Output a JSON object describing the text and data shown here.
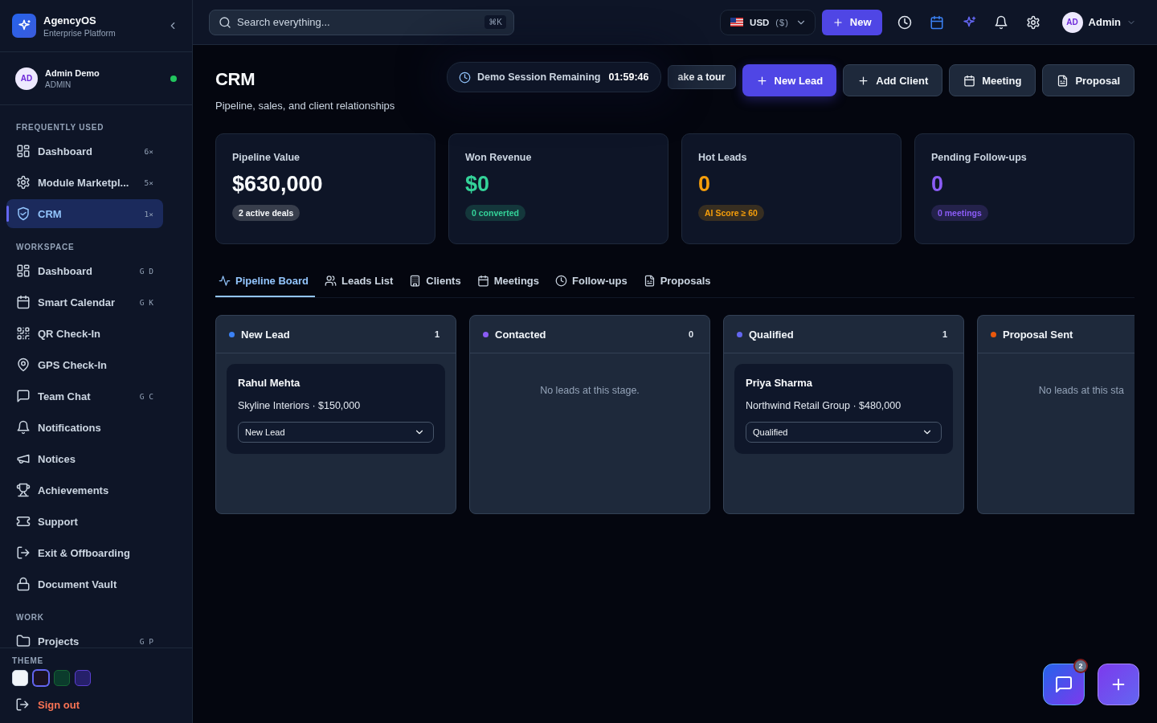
{
  "sidebar": {
    "brand": {
      "name": "AgencyOS",
      "subtitle": "Enterprise Platform"
    },
    "user": {
      "initials": "AD",
      "name": "Admin Demo",
      "role": "ADMIN",
      "online": true
    },
    "sections": [
      {
        "title": "FREQUENTLY USED",
        "items": [
          {
            "label": "Dashboard",
            "hint": "6×",
            "selected": false
          },
          {
            "label": "Module Marketpl...",
            "hint": "5×",
            "selected": false
          },
          {
            "label": "CRM",
            "hint": "1×",
            "selected": true
          }
        ]
      },
      {
        "title": "WORKSPACE",
        "items": [
          {
            "label": "Dashboard",
            "hint": "G D",
            "selected": false
          },
          {
            "label": "Smart Calendar",
            "hint": "G K",
            "selected": false
          },
          {
            "label": "QR Check-In",
            "selected": false
          },
          {
            "label": "GPS Check-In",
            "selected": false
          },
          {
            "label": "Team Chat",
            "hint": "G C",
            "selected": false
          },
          {
            "label": "Notifications",
            "selected": false
          },
          {
            "label": "Notices",
            "selected": false
          },
          {
            "label": "Achievements",
            "selected": false
          },
          {
            "label": "Support",
            "selected": false
          },
          {
            "label": "Exit & Offboarding",
            "selected": false
          },
          {
            "label": "Document Vault",
            "selected": false
          }
        ]
      },
      {
        "title": "WORK",
        "items": [
          {
            "label": "Projects",
            "hint": "G P",
            "selected": false
          }
        ]
      }
    ],
    "theme": {
      "title": "THEME",
      "swatches": [
        {
          "color": "#f1f5f9",
          "selected": false
        },
        {
          "color": "#1a1222",
          "selected": true
        },
        {
          "color": "#0b3b2c",
          "selected": false
        },
        {
          "color": "#26206a",
          "selected": false
        }
      ]
    },
    "sign_out": "Sign out"
  },
  "topbar": {
    "search": {
      "placeholder": "Search everything...",
      "shortcut": "⌘K"
    },
    "currency": {
      "code": "USD",
      "symbol": "($)"
    },
    "new_button": "New",
    "user": {
      "initials": "AD",
      "name": "Admin"
    }
  },
  "page": {
    "title": "CRM",
    "subtitle": "Pipeline, sales, and client relationships",
    "demo": {
      "label": "Demo Session Remaining",
      "time": "01:59:46"
    },
    "tour_button": "ake a tour",
    "actions": [
      {
        "label": "New Lead",
        "kind": "primary"
      },
      {
        "label": "Add Client",
        "kind": "secondary"
      },
      {
        "label": "Meeting",
        "kind": "secondary"
      },
      {
        "label": "Proposal",
        "kind": "secondary"
      }
    ]
  },
  "stats": [
    {
      "label": "Pipeline Value",
      "value": "$630,000",
      "badge": "2 active deals",
      "color": "#f8fafc"
    },
    {
      "label": "Won Revenue",
      "value": "$0",
      "badge": "0 converted",
      "color": "#34d399"
    },
    {
      "label": "Hot Leads",
      "value": "0",
      "badge": "AI Score ≥ 60",
      "color": "#f59e0b"
    },
    {
      "label": "Pending Follow-ups",
      "value": "0",
      "badge": "0 meetings",
      "color": "#8b5cf6"
    }
  ],
  "tabs": [
    {
      "label": "Pipeline Board",
      "selected": true
    },
    {
      "label": "Leads List",
      "selected": false
    },
    {
      "label": "Clients",
      "selected": false
    },
    {
      "label": "Meetings",
      "selected": false
    },
    {
      "label": "Follow-ups",
      "selected": false
    },
    {
      "label": "Proposals",
      "selected": false
    }
  ],
  "pipeline": [
    {
      "name": "New Lead",
      "count": "1",
      "color": "#3b82f6",
      "leads": [
        {
          "name": "Rahul Mehta",
          "detail": "Skyline Interiors · $150,000",
          "stage": "New Lead"
        }
      ]
    },
    {
      "name": "Contacted",
      "count": "0",
      "color": "#8b5cf6",
      "empty_text": "No leads at this stage."
    },
    {
      "name": "Qualified",
      "count": "1",
      "color": "#6366f1",
      "leads": [
        {
          "name": "Priya Sharma",
          "detail": "Northwind Retail Group · $480,000",
          "stage": "Qualified"
        }
      ]
    },
    {
      "name": "Proposal Sent",
      "color": "#ea580c",
      "empty_text": "No leads at this sta"
    }
  ],
  "fab": {
    "badge": "2"
  }
}
